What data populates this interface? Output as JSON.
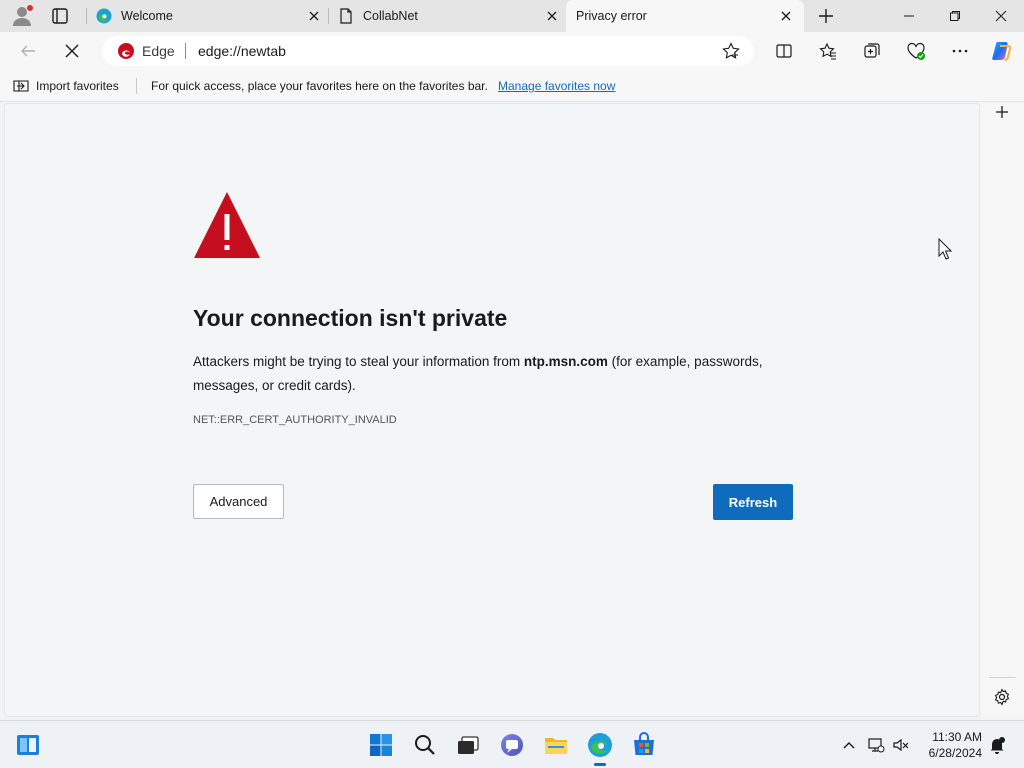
{
  "tabs": [
    {
      "title": "Welcome",
      "icon": "edge-logo-icon",
      "active": false
    },
    {
      "title": "CollabNet",
      "icon": "page-icon",
      "active": false
    },
    {
      "title": "Privacy error",
      "icon": "loading-icon",
      "active": true
    }
  ],
  "omnibox": {
    "brand": "Edge",
    "url": "edge://newtab"
  },
  "favorites_bar": {
    "import_label": "Import favorites",
    "hint": "For quick access, place your favorites here on the favorites bar.",
    "manage_link": "Manage favorites now"
  },
  "error_page": {
    "title": "Your connection isn't private",
    "desc_before": "Attackers might be trying to steal your information from ",
    "host": "ntp.msn.com",
    "desc_after": " (for example, passwords, messages, or credit cards).",
    "error_code": "NET::ERR_CERT_AUTHORITY_INVALID",
    "advanced_label": "Advanced",
    "refresh_label": "Refresh"
  },
  "taskbar": {
    "time": "11:30 AM",
    "date": "6/28/2024"
  },
  "colors": {
    "accent": "#0f6cbd",
    "warning_red": "#c50f1f"
  }
}
